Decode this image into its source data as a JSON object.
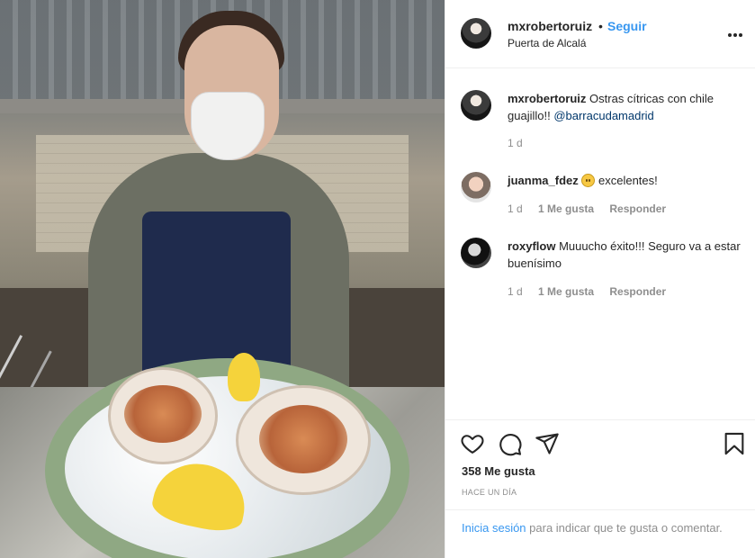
{
  "post": {
    "username": "mxrobertoruiz",
    "separator": "•",
    "follow_label": "Seguir",
    "location": "Puerta de Alcalá"
  },
  "caption": {
    "username": "mxrobertoruiz",
    "text": "Ostras cítricas con chile guajillo!! ",
    "mention": "@barracudamadrid",
    "time": "1 d"
  },
  "comments": [
    {
      "username": "juanma_fdez",
      "text": "excelentes!",
      "emoji": "smiling-face-icon",
      "time": "1 d",
      "likes_label": "1 Me gusta",
      "reply_label": "Responder"
    },
    {
      "username": "roxyflow",
      "text": "Muuucho éxito!!! Seguro va a estar buenísimo",
      "time": "1 d",
      "likes_label": "1 Me gusta",
      "reply_label": "Responder"
    }
  ],
  "actions": {
    "icons": [
      "heart-icon",
      "comment-icon",
      "share-icon",
      "bookmark-icon"
    ],
    "likes_count": "358 Me gusta",
    "posted_ago": "HACE UN DÍA"
  },
  "login_prompt": {
    "link": "Inicia sesión",
    "rest": " para indicar que te gusta o comentar."
  },
  "colors": {
    "link_blue": "#3897f0",
    "text": "#262626",
    "muted": "#8e8e8e",
    "mention": "#00376b"
  }
}
